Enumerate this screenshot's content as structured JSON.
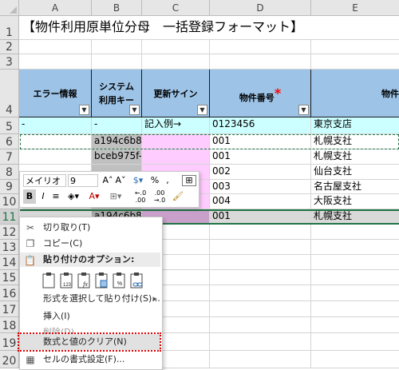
{
  "columns": [
    "A",
    "B",
    "C",
    "D",
    "E"
  ],
  "rows": [
    "1",
    "2",
    "3",
    "4",
    "5",
    "6",
    "7",
    "8",
    "9",
    "10",
    "11",
    "12",
    "13",
    "14",
    "15",
    "16",
    "17",
    "18",
    "19",
    "20"
  ],
  "title": "【物件利用原単位分母　一括登録フォーマット】",
  "headers": {
    "a": "エラー情報",
    "b1": "システム",
    "b2": "利用キー",
    "c": "更新サイン",
    "d": "物件番号",
    "required_mark": "*",
    "e": "物件",
    "dropdown_glyph": "▼"
  },
  "example_row": {
    "a": "-",
    "b": "-",
    "c": "記入例→",
    "d": "0123456",
    "e": "東京支店"
  },
  "data_rows": [
    {
      "b": "a194c6b8",
      "d": "001",
      "e": "札幌支社"
    },
    {
      "b": "bceb975f-",
      "d": "001",
      "e": "札幌支社"
    },
    {
      "b": "",
      "d": "002",
      "e": "仙台支社"
    },
    {
      "b": "",
      "d": "003",
      "e": "名古屋支社"
    },
    {
      "b": "",
      "d": "004",
      "e": "大阪支社"
    },
    {
      "b": "a194c6b8",
      "d": "001",
      "e": "札幌支社"
    }
  ],
  "mini_toolbar": {
    "font_name": "メイリオ",
    "font_size": "9",
    "grow_font": "A˄",
    "shrink_font": "A˅",
    "percent": "%",
    "comma": ",",
    "bold": "B",
    "italic": "I",
    "dec_increase": "←.0\n.00",
    "dec_decrease": ".00\n→.0"
  },
  "context_menu": {
    "cut": "切り取り(T)",
    "copy": "コピー(C)",
    "paste_options_header": "貼り付けのオプション:",
    "paste_special": "形式を選択して貼り付け(S)...",
    "insert": "挿入(I)",
    "delete": "削除(D)",
    "clear_contents": "数式と値のクリア(N)",
    "format_cells": "セルの書式設定(F)..."
  },
  "colors": {
    "header_blue": "#9dc3e6",
    "example_cyan": "#ccffff",
    "system_key_gray": "#c0c0c0",
    "update_pink": "#ffccff",
    "selection_green": "#217346",
    "highlight_red": "#e00000",
    "required_red": "#ff0000"
  }
}
